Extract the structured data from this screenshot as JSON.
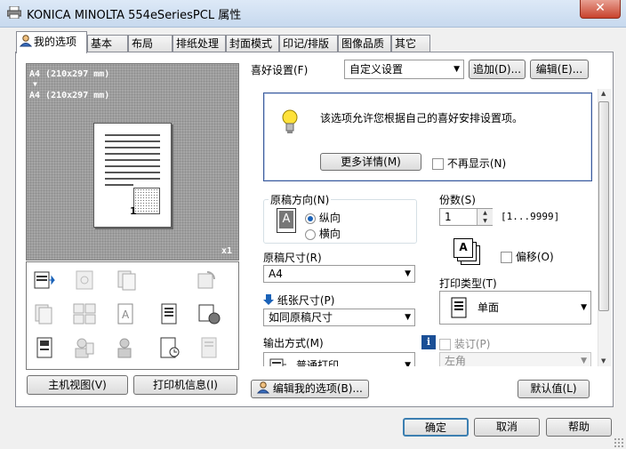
{
  "window": {
    "title": "KONICA MINOLTA 554eSeriesPCL 属性",
    "close_glyph": "✕"
  },
  "tabs": [
    {
      "label": "我的选项",
      "active": true
    },
    {
      "label": "基本"
    },
    {
      "label": "布局"
    },
    {
      "label": "排纸处理"
    },
    {
      "label": "封面模式"
    },
    {
      "label": "印记/排版"
    },
    {
      "label": "图像品质"
    },
    {
      "label": "其它"
    }
  ],
  "preview": {
    "line1": "A4  (210x297  mm)",
    "arrow": "▼",
    "line2": "A4  (210x297  mm)",
    "page_number": "1",
    "copies_badge": "x1"
  },
  "left_buttons": {
    "main_view": "主机视图(V)",
    "printer_info": "打印机信息(I)"
  },
  "favorites": {
    "label": "喜好设置(F)",
    "value": "自定义设置",
    "add": "追加(D)...",
    "edit": "编辑(E)..."
  },
  "info": {
    "message": "该选项允许您根据自己的喜好安排设置项。",
    "more_details": "更多详情(M)",
    "dont_show": "不再显示(N)"
  },
  "orientation": {
    "label": "原稿方向(N)",
    "portrait": "纵向",
    "landscape": "横向",
    "icon_letter": "A"
  },
  "original_size": {
    "label": "原稿尺寸(R)",
    "value": "A4"
  },
  "paper_size": {
    "label": "纸张尺寸(P)",
    "value": "如同原稿尺寸"
  },
  "output": {
    "label": "输出方式(M)",
    "value": "普通打印"
  },
  "copies": {
    "label": "份数(S)",
    "value": "1",
    "range": "[1...9999]",
    "offset": "偏移(O)",
    "icon_letter": "A"
  },
  "print_type": {
    "label": "打印类型(T)",
    "value": "单面"
  },
  "staple": {
    "label": "装订(P)",
    "value": "左角"
  },
  "bottom": {
    "edit_my_tab": "编辑我的选项(B)...",
    "default": "默认值(L)",
    "ok": "确定",
    "cancel": "取消",
    "help": "帮助"
  },
  "colors": {
    "accent": "#1a62b8",
    "frame": "#898c95",
    "preview_bg": "#a6a6a6"
  }
}
